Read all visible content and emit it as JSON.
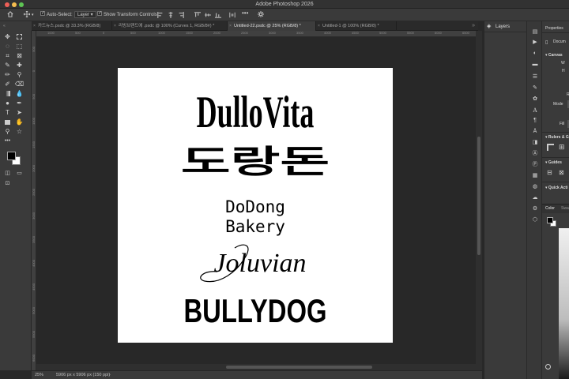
{
  "window": {
    "title": "Adobe Photoshop 2026"
  },
  "options_bar": {
    "auto_select_label": "Auto-Select:",
    "auto_select_target": "Layer",
    "show_transform_label": "Show Transform Controls"
  },
  "tabs": [
    {
      "label": "카드뉴스.psdc @ 33.3% (RGB/8)",
      "active": false
    },
    {
      "label": "리빙브랜드에 .psdc @ 100% (Curves 1, RGB/8#) *",
      "active": false
    },
    {
      "label": "Untitled-22.psdc @ 25% (RGB/8) *",
      "active": true
    },
    {
      "label": "Untitled-1 @ 100% (RGB/8) *",
      "active": false
    }
  ],
  "ruler": {
    "h": [
      "1000",
      "500",
      "0",
      "500",
      "1000",
      "1500",
      "2000",
      "2500",
      "3000",
      "3500",
      "4000",
      "4500",
      "5000",
      "5500",
      "6000",
      "6500",
      "7000"
    ],
    "v": [
      "500",
      "0",
      "500",
      "1000",
      "1500",
      "2000",
      "2500",
      "3000",
      "3500",
      "4000",
      "4500",
      "5000",
      "5500",
      "6000"
    ]
  },
  "artboard": {
    "logos": [
      "DulloVita",
      "도랑돈",
      "DoDong",
      "Bakery",
      "Joluvian",
      "BULLYDOG"
    ]
  },
  "status": {
    "zoom": "25%",
    "doc_size": "5906 px x 5906 px (150 ppi)"
  },
  "panels": {
    "layers_title": "Layers",
    "properties_title": "Properties",
    "properties_doc": "Docum",
    "canvas_label": "Canvas",
    "w_label": "W",
    "h_label": "H",
    "r_label": "R",
    "mode_label": "Mode",
    "fill_label": "Fill",
    "rulers_label": "Rulers & G",
    "guides_label": "Guides",
    "quick_actions_label": "Quick Acti",
    "color_tab": "Color",
    "swatches_tab": "Swa"
  },
  "colors": {
    "foreground": "#000000",
    "background": "#ffffff",
    "accent": "#1473e6"
  }
}
